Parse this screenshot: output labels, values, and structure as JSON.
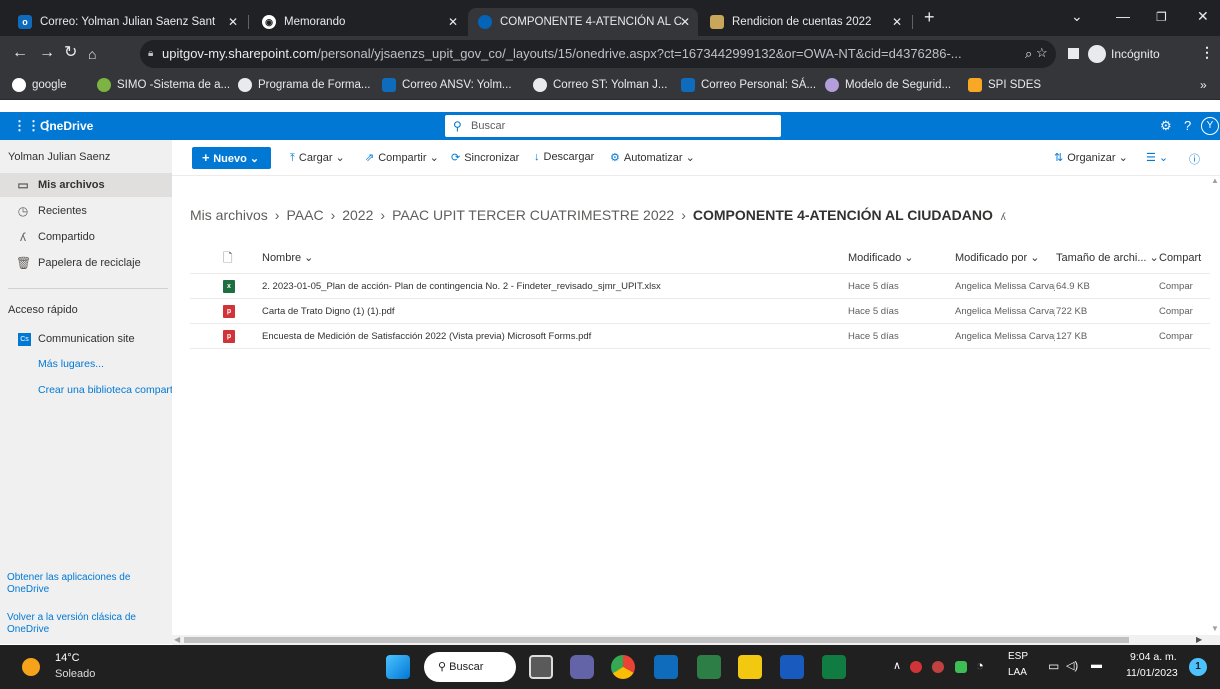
{
  "browser": {
    "tabs": [
      {
        "label": "Correo: Yolman Julian Saenz Sant"
      },
      {
        "label": "Memorando"
      },
      {
        "label": "COMPONENTE 4-ATENCIÓN AL C"
      },
      {
        "label": "Rendicion de cuentas 2022"
      }
    ],
    "url_host": "upitgov-my.sharepoint.com",
    "url_path": "/personal/yjsaenzs_upit_gov_co/_layouts/15/onedrive.aspx?ct=1673442999132&or=OWA-NT&cid=d4376286-...",
    "incognito_label": "Incógnito",
    "bookmarks": [
      {
        "label": "google"
      },
      {
        "label": "SIMO -Sistema de a..."
      },
      {
        "label": "Programa de Forma..."
      },
      {
        "label": "Correo ANSV: Yolm..."
      },
      {
        "label": "Correo ST: Yolman J..."
      },
      {
        "label": "Correo Personal: SÁ..."
      },
      {
        "label": "Modelo de Segurid..."
      },
      {
        "label": "SPI SDES"
      }
    ]
  },
  "onedrive": {
    "app_name": "OneDrive",
    "search_placeholder": "Buscar",
    "avatar_initial": "Y"
  },
  "sidebar": {
    "user_name": "Yolman Julian Saenz",
    "items": [
      {
        "label": "Mis archivos"
      },
      {
        "label": "Recientes"
      },
      {
        "label": "Compartido"
      },
      {
        "label": "Papelera de reciclaje"
      }
    ],
    "quick_access_title": "Acceso rápido",
    "communication_site": "Communication site",
    "more_places": "Más lugares...",
    "create_library": "Crear una biblioteca compart",
    "get_apps": "Obtener las aplicaciones de OneDrive",
    "classic_version": "Volver a la versión clásica de OneDrive"
  },
  "commandbar": {
    "nuevo": "Nuevo",
    "cargar": "Cargar",
    "compartir": "Compartir",
    "sincronizar": "Sincronizar",
    "descargar": "Descargar",
    "automatizar": "Automatizar",
    "organizar": "Organizar"
  },
  "breadcrumb": {
    "items": [
      "Mis archivos",
      "PAAC",
      "2022",
      "PAAC UPIT TERCER CUATRIMESTRE 2022"
    ],
    "current": "COMPONENTE 4-ATENCIÓN AL CIUDADANO"
  },
  "table": {
    "headers": {
      "name": "Nombre",
      "modified": "Modificado",
      "modified_by": "Modificado por",
      "size": "Tamaño de archi...",
      "sharing": "Compart"
    },
    "rows": [
      {
        "name": "2. 2023-01-05_Plan de acción- Plan de contingencia No. 2 - Findeter_revisado_sjmr_UPIT.xlsx",
        "modified": "Hace 5 días",
        "modified_by": "Angelica Melissa Carvajal I",
        "size": "64.9 KB",
        "sharing": "Compar",
        "type": "xlsx"
      },
      {
        "name": "Carta de Trato Digno (1) (1).pdf",
        "modified": "Hace 5 días",
        "modified_by": "Angelica Melissa Carvajal I",
        "size": "722 KB",
        "sharing": "Compar",
        "type": "pdf"
      },
      {
        "name": "Encuesta de Medición de Satisfacción 2022 (Vista previa) Microsoft Forms.pdf",
        "modified": "Hace 5 días",
        "modified_by": "Angelica Melissa Carvajal I",
        "size": "127 KB",
        "sharing": "Compar",
        "type": "pdf"
      }
    ]
  },
  "taskbar": {
    "temperature": "14°C",
    "weather": "Soleado",
    "search_label": "Buscar",
    "lang_top": "ESP",
    "lang_bottom": "LAA",
    "time": "9:04 a. m.",
    "date": "11/01/2023",
    "notifications": "1"
  },
  "colors": {
    "accent": "#0078d4",
    "tabbar": "#202124",
    "taskbar": "#202020"
  }
}
